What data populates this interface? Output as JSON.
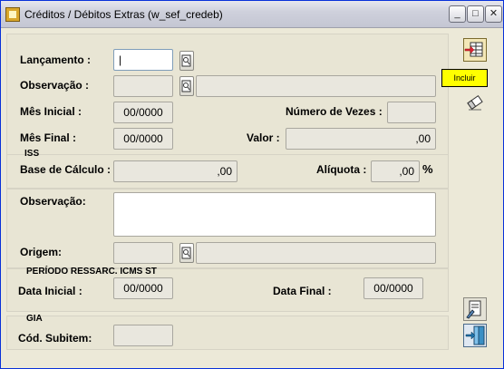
{
  "window": {
    "title": "Créditos / Débitos Extras (w_sef_credeb)",
    "minimize": "_",
    "maximize": "□",
    "close": "✕"
  },
  "form": {
    "lancamento": {
      "label": "Lançamento :",
      "value": "|"
    },
    "observacao": {
      "label": "Observação :",
      "code": "",
      "desc": ""
    },
    "mes_inicial": {
      "label": "Mês Inicial :",
      "value": "00/0000"
    },
    "numero_vezes": {
      "label": "Número de Vezes :",
      "value": ""
    },
    "mes_final": {
      "label": "Mês Final :",
      "value": "00/0000"
    },
    "valor": {
      "label": "Valor :",
      "value": ",00"
    },
    "iss": {
      "group": "ISS",
      "base_calculo": {
        "label": "Base de Cálculo :",
        "value": ",00"
      },
      "aliquota": {
        "label": "Alíquota :",
        "value": ",00",
        "suffix": "%"
      }
    },
    "observacao2": {
      "label": "Observação:",
      "value": ""
    },
    "origem": {
      "label": "Origem:",
      "code": "",
      "desc": ""
    },
    "periodo": {
      "group": "PERÍODO RESSARC. ICMS ST",
      "data_inicial": {
        "label": "Data Inicial :",
        "value": "00/0000"
      },
      "data_final": {
        "label": "Data Final :",
        "value": "00/0000"
      }
    },
    "gia": {
      "group": "GIA",
      "cod_subitem": {
        "label": "Cód. Subitem:",
        "value": ""
      }
    }
  },
  "sidebar": {
    "tooltip": "Incluir"
  }
}
